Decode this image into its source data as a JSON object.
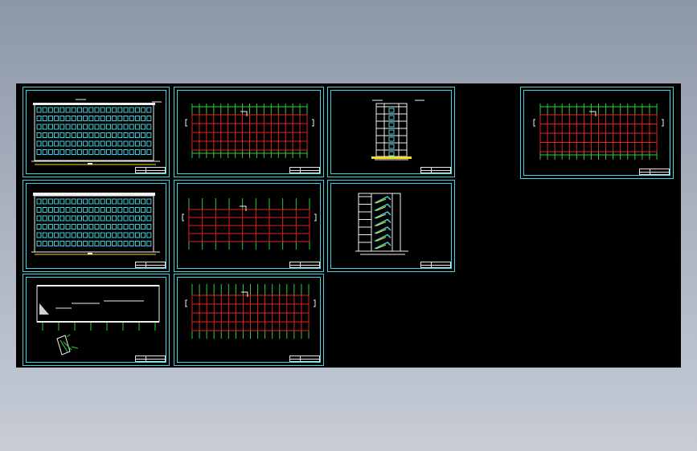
{
  "viewport": {
    "background": "#000000",
    "frame_color": "#3fd3e0",
    "grid_color": "#e02020",
    "axis_color": "#2ecc40",
    "window_color": "#3fd3e0",
    "outline_color": "#f0f0f0",
    "ground_color": "#f0e020"
  },
  "sheets": [
    {
      "id": "sheet-front-elevation",
      "kind": "elevation"
    },
    {
      "id": "sheet-foundation-plan-1",
      "kind": "plan"
    },
    {
      "id": "sheet-section",
      "kind": "section"
    },
    {
      "id": "sheet-back-elevation",
      "kind": "elevation"
    },
    {
      "id": "sheet-floor-plan",
      "kind": "plan"
    },
    {
      "id": "sheet-stair-section",
      "kind": "stair"
    },
    {
      "id": "sheet-detail",
      "kind": "detail"
    },
    {
      "id": "sheet-foundation-plan-2",
      "kind": "plan"
    },
    {
      "id": "sheet-roof-plan",
      "kind": "plan"
    }
  ]
}
